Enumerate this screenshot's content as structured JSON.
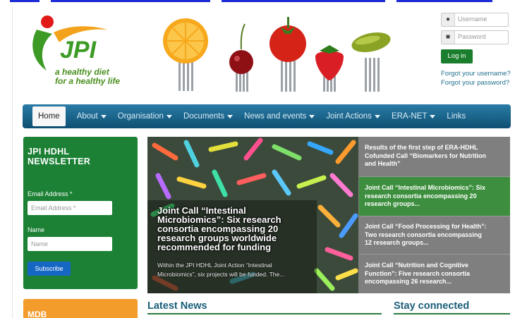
{
  "header": {
    "logo_text": "JPI",
    "tagline_line1": "a healthy diet",
    "tagline_line2": "for a healthy life"
  },
  "login": {
    "username_placeholder": "Username",
    "password_placeholder": "Password",
    "login_button": "Log in",
    "forgot_username": "Forgot your username?",
    "forgot_password": "Forgot your password?"
  },
  "nav": {
    "items": [
      "Home",
      "About",
      "Organisation",
      "Documents",
      "News and events",
      "Joint Actions",
      "ERA-NET",
      "Links"
    ]
  },
  "newsletter": {
    "title_line1": "JPI HDHL",
    "title_line2": "NEWSLETTER",
    "email_label": "Email Address *",
    "email_placeholder": "Email Address *",
    "name_label": "Name",
    "name_placeholder": "Name",
    "subscribe_button": "Subscribe"
  },
  "mdb": {
    "title": "MDB"
  },
  "slideshow": {
    "caption_lines": [
      "Joint Call “Intestinal",
      "Microbiomics”: Six research",
      "consortia encompassing 20",
      "research groups worldwide",
      "recommended for funding"
    ],
    "description_lines": [
      "Within the JPI HDHL Joint Action “Intestinal",
      "Microbiomics”, six projects will be funded. The..."
    ],
    "list": [
      {
        "lines": [
          "Results of the first step of ERA-HDHL",
          "Cofunded Call “Biomarkers for Nutrition",
          "and Health”"
        ]
      },
      {
        "lines": [
          "Joint Call “Intestinal Microbiomics”: Six",
          "research consortia encompassing 20",
          "research groups..."
        ]
      },
      {
        "lines": [
          "Joint Call “Food Processing for Health”:",
          "Two research consortia encompassing",
          "12 research groups..."
        ]
      },
      {
        "lines": [
          "Joint Call “Nutrition and Cognitive",
          "Function”: Five research consortia",
          "encompassing 26 research..."
        ]
      }
    ]
  },
  "sections": {
    "latest_news": "Latest News",
    "stay_connected": "Stay connected"
  },
  "colors": {
    "nav": "#1a6a94",
    "green": "#1c8135",
    "orange": "#f39c2b",
    "active_list": "#3d8f3f",
    "subscribe": "#1667c4"
  }
}
